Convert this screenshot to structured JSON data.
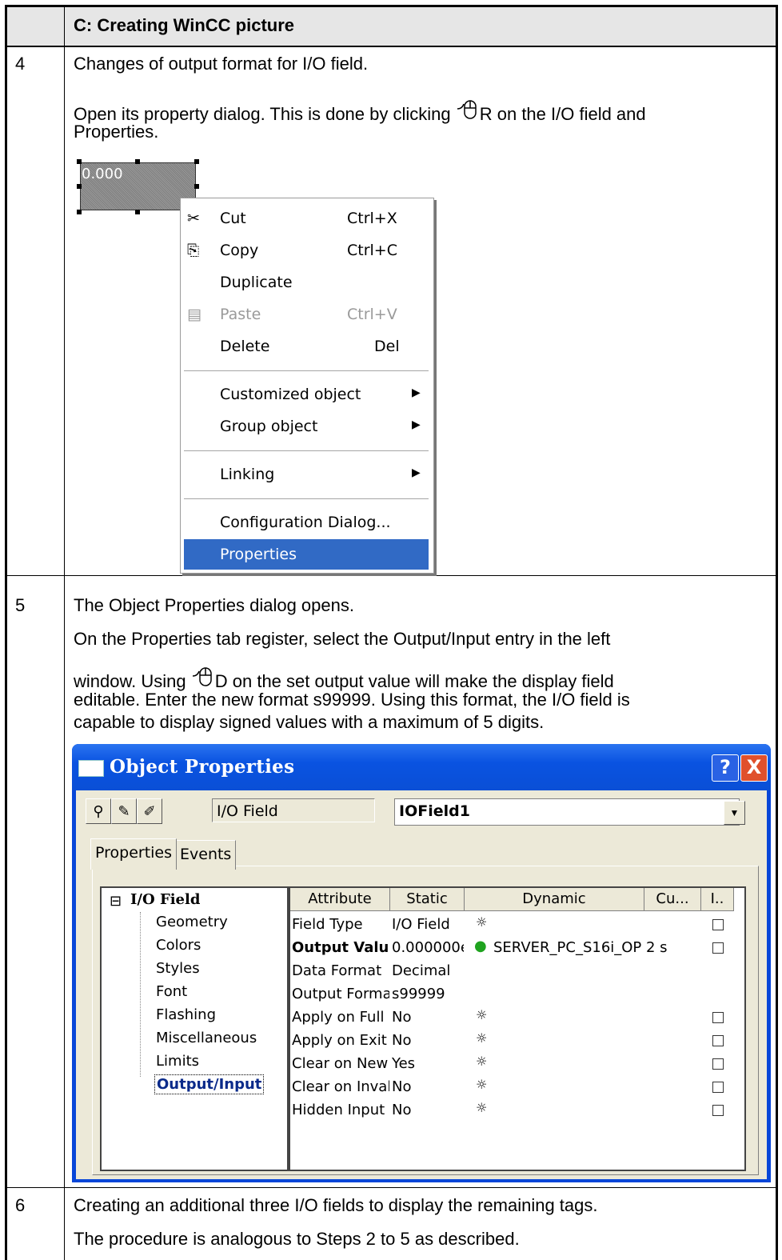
{
  "header": {
    "title": "C: Creating WinCC picture"
  },
  "step4": {
    "number": "4",
    "line1": "Changes of output format for I/O field.",
    "line2a": "Open its property dialog. This is done by clicking ",
    "line2b": "R on the I/O field and",
    "line3": "Properties.",
    "io_value": "0.000",
    "menu": {
      "cut": "Cut",
      "cut_sc": "Ctrl+X",
      "copy": "Copy",
      "copy_sc": "Ctrl+C",
      "duplicate": "Duplicate",
      "paste": "Paste",
      "paste_sc": "Ctrl+V",
      "delete": "Delete",
      "delete_sc": "Del",
      "customized": "Customized object",
      "group": "Group object",
      "linking": "Linking",
      "config": "Configuration Dialog...",
      "properties": "Properties"
    }
  },
  "step5": {
    "number": "5",
    "line1": "The Object Properties dialog opens.",
    "line2": "On the Properties tab register, select the Output/Input entry in the left",
    "line3a": "window. Using ",
    "line3b": "D on the set output value will make the display field",
    "line4": "editable. Enter the new format s99999. Using this format, the I/O field is",
    "line5": "capable to display signed values with a maximum of 5 digits.",
    "dialog": {
      "title": "Object Properties",
      "help": "?",
      "close": "X",
      "type_field": "I/O Field",
      "name_field": "IOField1",
      "tab_properties": "Properties",
      "tab_events": "Events",
      "tree_root": "I/O Field",
      "tree": [
        "Geometry",
        "Colors",
        "Styles",
        "Font",
        "Flashing",
        "Miscellaneous",
        "Limits",
        "Output/Input"
      ],
      "columns": [
        "Attribute",
        "Static",
        "Dynamic",
        "Cu...",
        "I.."
      ],
      "rows": [
        {
          "attr": "Field Type",
          "static": "I/O Field",
          "dynamic": ""
        },
        {
          "attr": "Output Valu",
          "static": "0.000000e",
          "dynamic": "SERVER_PC_S16i_OP 2 s"
        },
        {
          "attr": "Data Format",
          "static": "Decimal",
          "dynamic": ""
        },
        {
          "attr": "Output Forma",
          "static": "s99999",
          "dynamic": ""
        },
        {
          "attr": "Apply on Full",
          "static": "No",
          "dynamic": ""
        },
        {
          "attr": "Apply on Exit",
          "static": "No",
          "dynamic": ""
        },
        {
          "attr": "Clear on New",
          "static": "Yes",
          "dynamic": ""
        },
        {
          "attr": "Clear on Inval",
          "static": "No",
          "dynamic": ""
        },
        {
          "attr": "Hidden Input",
          "static": "No",
          "dynamic": ""
        }
      ]
    }
  },
  "step6": {
    "number": "6",
    "line1": "Creating an additional three I/O fields to display the remaining tags.",
    "line2": "The procedure is analogous to Steps 2 to 5 as described."
  },
  "colors": {
    "selection": "#316ac5",
    "titlebar": "#0a53e1",
    "close": "#e0502c",
    "header_bg": "#e6e6e6",
    "bulb_green": "#1fa31f"
  }
}
